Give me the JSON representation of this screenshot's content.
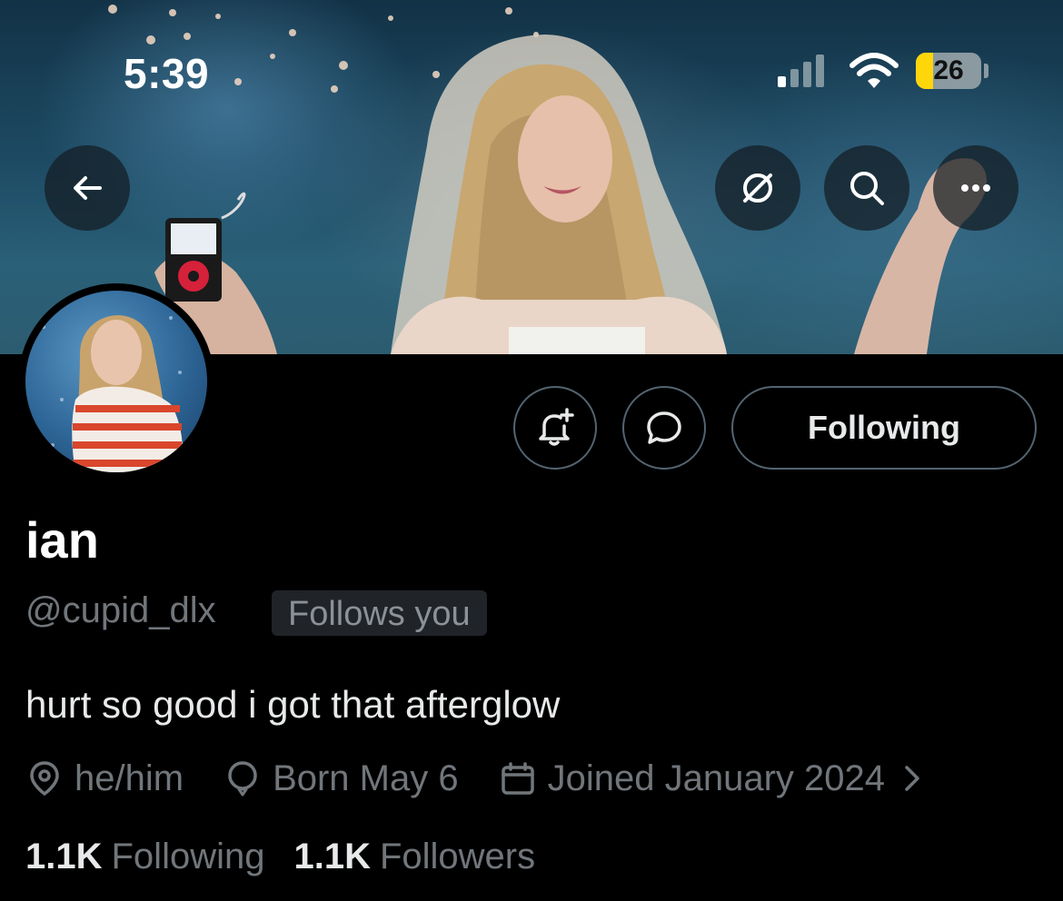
{
  "status_bar": {
    "time": "5:39",
    "battery_level": "26",
    "battery_fraction": 0.26,
    "signal_icon": "cellular-signal-icon",
    "wifi_icon": "wifi-icon"
  },
  "header_buttons": {
    "back_icon": "arrow-left-icon",
    "grok_icon": "slashed-circle-icon",
    "search_icon": "search-icon",
    "more_icon": "more-horizontal-icon"
  },
  "profile": {
    "display_name": "ian",
    "handle": "@cupid_dlx",
    "follows_you_badge": "Follows you",
    "bio": "hurt so good i got that afterglow",
    "pronouns": "he/him",
    "birthday": "Born May 6",
    "joined": "Joined January 2024",
    "following_count": "1.1K",
    "following_label": "Following",
    "followers_count": "1.1K",
    "followers_label": "Followers"
  },
  "actions": {
    "notify_icon": "bell-plus-icon",
    "message_icon": "message-bubble-icon",
    "following_button_label": "Following"
  },
  "colors": {
    "background": "#000000",
    "primary_text": "#e7e9ea",
    "secondary_text": "#71767b",
    "border": "#536471",
    "battery_fill": "#ffd60a"
  }
}
